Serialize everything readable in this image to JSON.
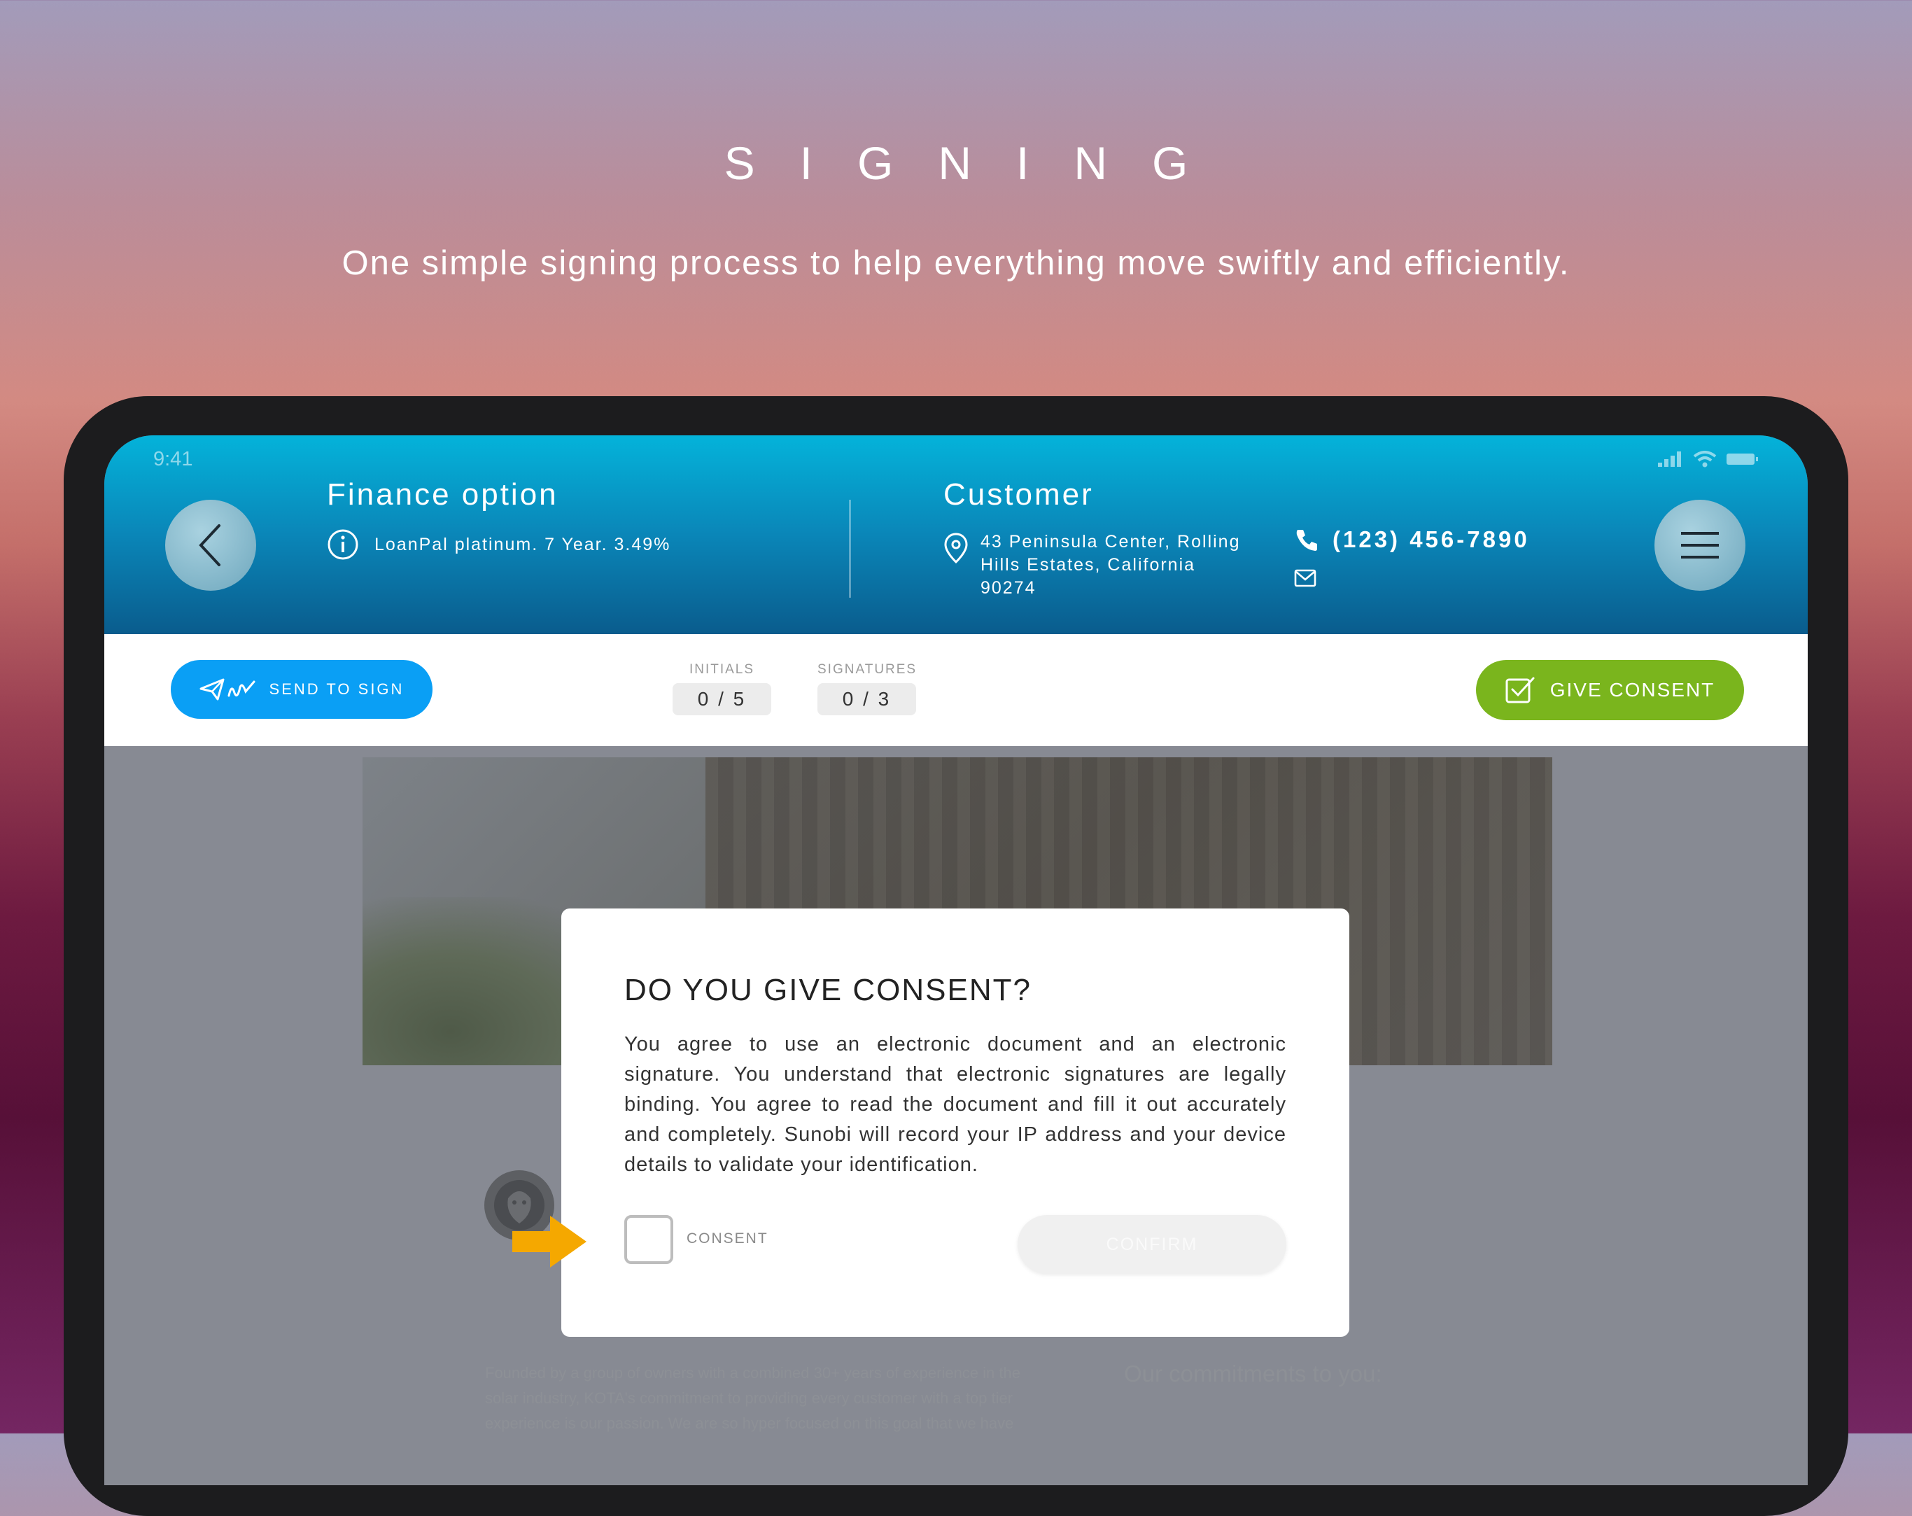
{
  "hero": {
    "title": "SIGNING",
    "subtitle": "One simple signing process to help everything move swiftly and efficiently."
  },
  "status_bar": {
    "time": "9:41"
  },
  "header": {
    "finance": {
      "title": "Finance option",
      "detail": "LoanPal platinum. 7 Year. 3.49%"
    },
    "customer": {
      "title": "Customer",
      "address_line1": "43 Peninsula Center, Rolling",
      "address_line2": "Hills Estates, California",
      "address_line3": "90274",
      "phone": "(123) 456-7890"
    }
  },
  "toolbar": {
    "send_label": "SEND TO SIGN",
    "initials_label": "INITIALS",
    "initials_value": "0 / 5",
    "signatures_label": "SIGNATURES",
    "signatures_value": "0 / 3",
    "consent_label": "GIVE CONSENT"
  },
  "document": {
    "intro_text": "Founded by a group of owners with a combined 30+ years of experience in the solar industry, KOTA's commitment to providing every customer with a top tier experience is our passion. We are so hyper focused on this goal that we have",
    "commitments_heading": "Our commitments to you:"
  },
  "modal": {
    "title": "DO YOU GIVE CONSENT?",
    "body": "You agree to use an electronic document and an electronic signature. You understand that electronic signatures are legally binding. You agree to read the document and fill it out accurately and completely. Sunobi will record your IP address and your device details to validate your identification.",
    "checkbox_label": "CONSENT",
    "confirm_label": "CONFIRM"
  },
  "colors": {
    "header_top": "#04b3da",
    "header_bottom": "#0a5c8d",
    "send_button": "#0a9ff5",
    "consent_button": "#7ab51d",
    "arrow": "#f5a800"
  }
}
